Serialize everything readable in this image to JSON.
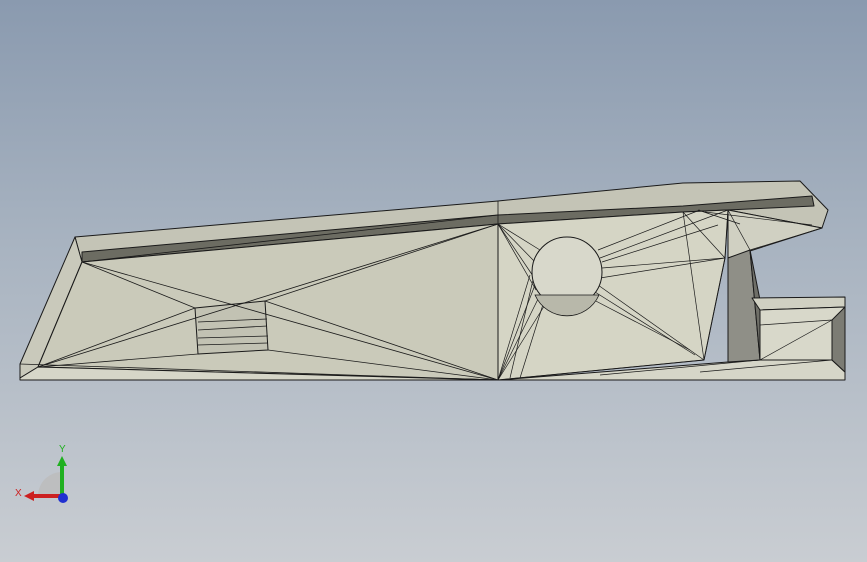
{
  "viewport": {
    "background_top": "#8a9aaf",
    "background_bottom": "#c9cdd2",
    "face_color": "#d5d5c6",
    "face_dark": "#b9b9ac",
    "edge_color": "#1a1a1a"
  },
  "triad": {
    "x_label": "X",
    "y_label": "Y",
    "x_color": "#cc2020",
    "y_color": "#20b020",
    "z_color": "#2030d0"
  }
}
